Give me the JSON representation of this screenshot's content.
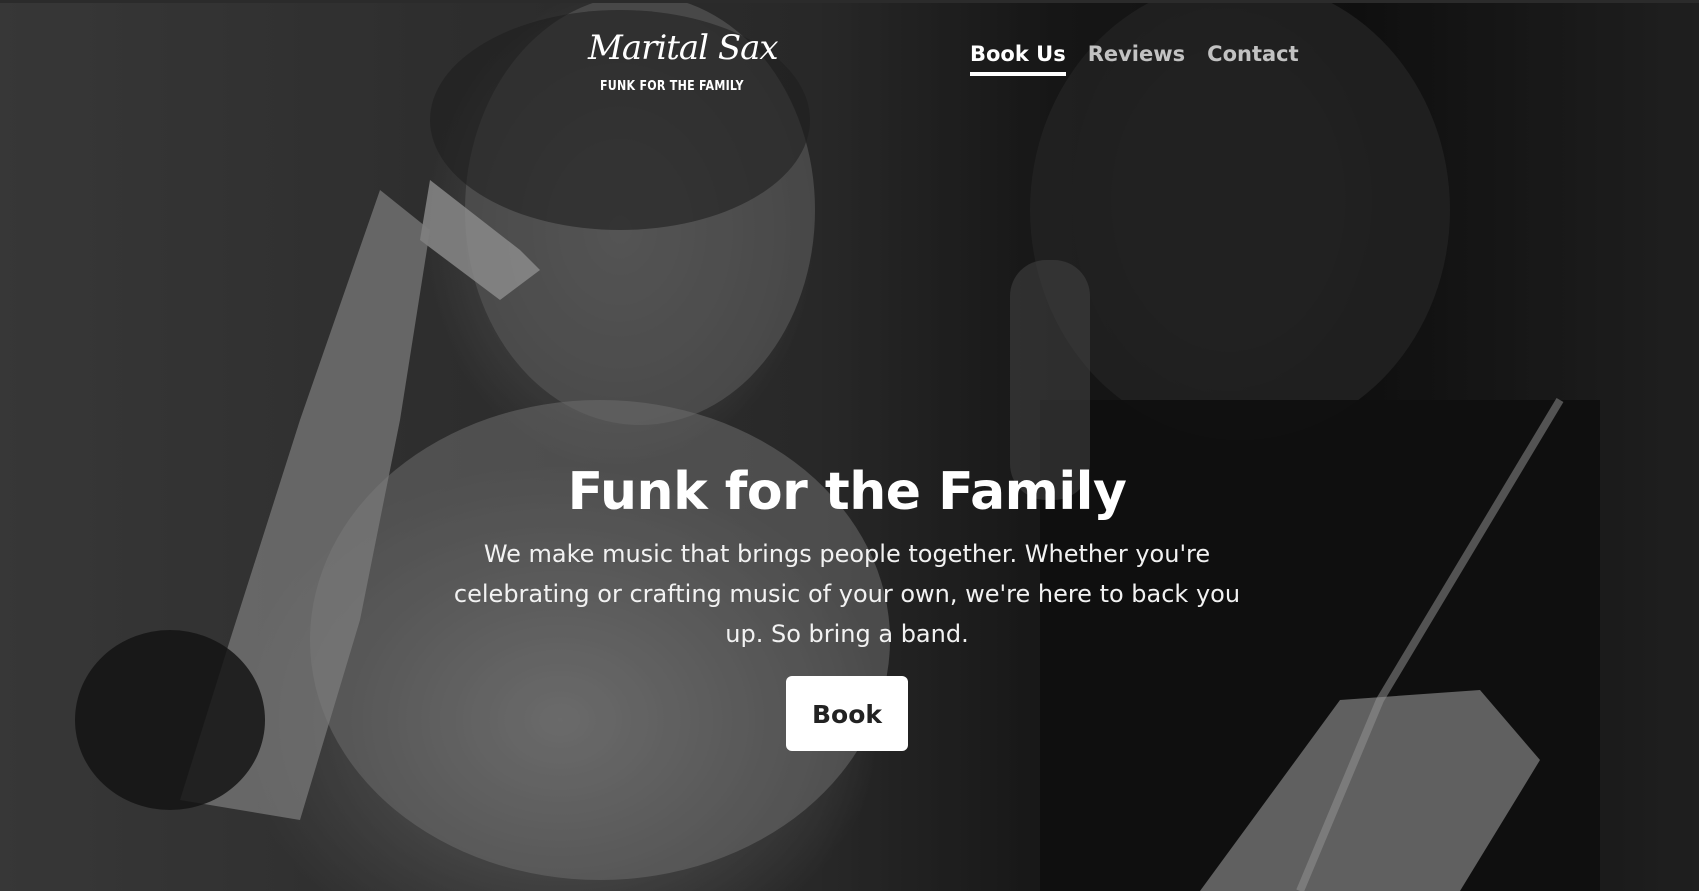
{
  "logo": {
    "script_text": "Marital Sax",
    "tagline": "FUNK FOR THE FAMILY"
  },
  "nav": {
    "items": [
      {
        "label": "Book Us",
        "active": true
      },
      {
        "label": "Reviews",
        "active": false
      },
      {
        "label": "Contact",
        "active": false
      }
    ]
  },
  "hero": {
    "title": "Funk for the Family",
    "text": "We make music that brings people together. Whether you're celebrating or crafting music of your own, we're here to back you up. So bring a band.",
    "button_label": "Book",
    "image_description_icon": "photo-two-saxophonists"
  },
  "colors": {
    "active_nav": "#ffffff",
    "inactive_nav": "#c2c2c2",
    "button_bg": "#ffffff",
    "button_text": "#222222"
  }
}
